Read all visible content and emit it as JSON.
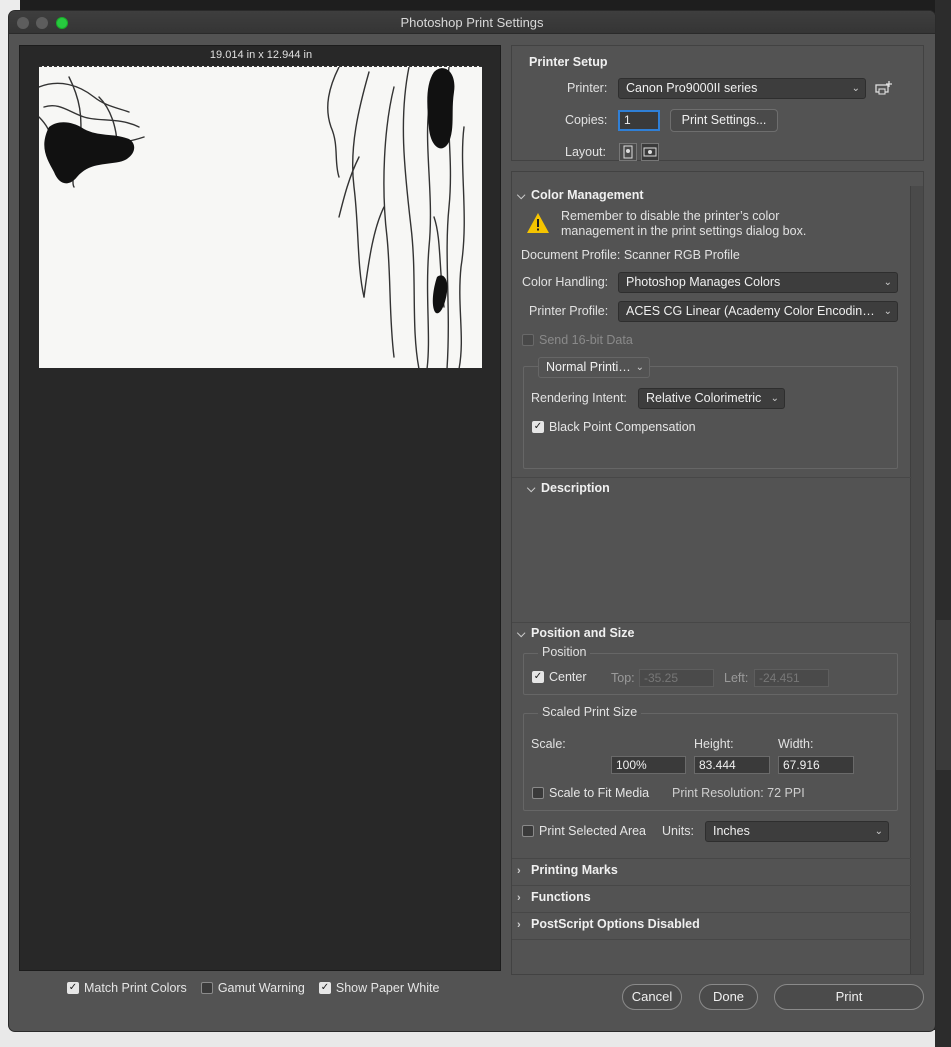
{
  "window": {
    "title": "Photoshop Print Settings"
  },
  "preview": {
    "dimensions": "19.014 in x 12.944 in",
    "match_print_colors": {
      "label": "Match Print Colors",
      "checked": true
    },
    "gamut_warning": {
      "label": "Gamut Warning",
      "checked": false
    },
    "show_paper_white": {
      "label": "Show Paper White",
      "checked": true
    }
  },
  "printer_setup": {
    "header": "Printer Setup",
    "printer_label": "Printer:",
    "printer_value": "Canon Pro9000II series",
    "copies_label": "Copies:",
    "copies_value": "1",
    "print_settings_button": "Print Settings...",
    "layout_label": "Layout:"
  },
  "color_management": {
    "header": "Color Management",
    "warning_line1": "Remember to disable the printer’s color",
    "warning_line2": "management in the print settings dialog box.",
    "document_profile": "Document Profile: Scanner RGB Profile",
    "color_handling_label": "Color Handling:",
    "color_handling_value": "Photoshop Manages Colors",
    "printer_profile_label": "Printer Profile:",
    "printer_profile_value": "ACES CG Linear (Academy Color Encoding Sy...",
    "send16bit_label": "Send 16-bit Data",
    "mode_value": "Normal Printing",
    "rendering_intent_label": "Rendering Intent:",
    "rendering_intent_value": "Relative Colorimetric",
    "black_point_label": "Black Point Compensation",
    "black_point_checked": true
  },
  "description": {
    "header": "Description"
  },
  "position_size": {
    "header": "Position and Size",
    "position_label": "Position",
    "center_label": "Center",
    "center_checked": true,
    "top_label": "Top:",
    "top_value": "-35.25",
    "left_label": "Left:",
    "left_value": "-24.451",
    "scaled_label": "Scaled Print Size",
    "scale_label": "Scale:",
    "scale_value": "100%",
    "height_label": "Height:",
    "height_value": "83.444",
    "width_label": "Width:",
    "width_value": "67.916",
    "scale_to_fit_label": "Scale to Fit Media",
    "print_resolution": "Print Resolution: 72 PPI",
    "print_selected_label": "Print Selected Area",
    "units_label": "Units:",
    "units_value": "Inches"
  },
  "sections": {
    "printing_marks": "Printing Marks",
    "functions": "Functions",
    "postscript": "PostScript Options Disabled"
  },
  "footer": {
    "cancel": "Cancel",
    "done": "Done",
    "print": "Print"
  },
  "colors": {
    "accent_green": "#27c93f",
    "focus_blue": "#2f7fd6",
    "warning_yellow": "#f5c400"
  }
}
